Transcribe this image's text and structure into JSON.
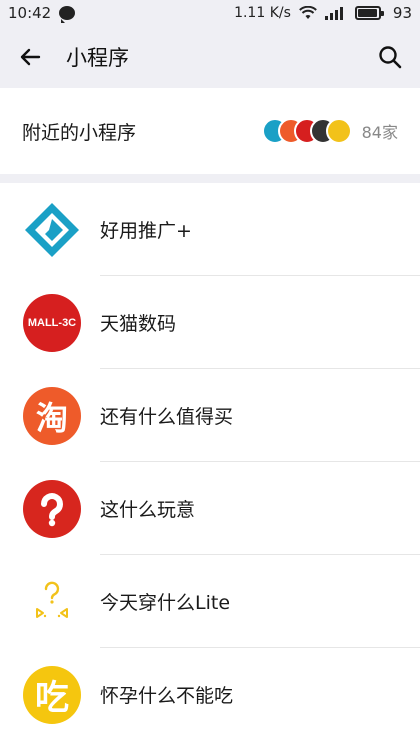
{
  "status_bar": {
    "time": "10:42",
    "speed": "1.11 K/s",
    "battery": "93"
  },
  "header": {
    "title": "小程序"
  },
  "nearby": {
    "label": "附近的小程序",
    "count": "84家"
  },
  "apps": [
    {
      "name": "好用推广+",
      "icon": "blue-cube-icon",
      "color": "#1aa0c6"
    },
    {
      "name": "天猫数码",
      "icon": "mall-3c-icon",
      "color": "#d61f1f",
      "icon_text": "MALL-3C"
    },
    {
      "name": "还有什么值得买",
      "icon": "tao-icon",
      "color": "#ee5b2a",
      "icon_text": "淘"
    },
    {
      "name": "这什么玩意",
      "icon": "question-mark-icon",
      "color": "#d7261e"
    },
    {
      "name": "今天穿什么Lite",
      "icon": "question-face-icon",
      "color": "#f2c21a"
    },
    {
      "name": "怀孕什么不能吃",
      "icon": "chi-icon",
      "color": "#f5c60f",
      "icon_text": "吃"
    }
  ]
}
